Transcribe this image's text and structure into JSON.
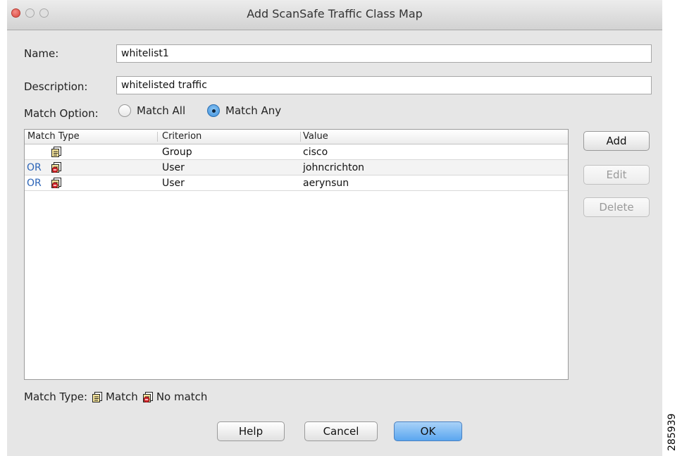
{
  "window": {
    "title": "Add ScanSafe Traffic Class Map"
  },
  "form": {
    "name_label": "Name:",
    "name_value": "whitelist1",
    "description_label": "Description:",
    "description_value": "whitelisted traffic",
    "match_option_label": "Match Option:",
    "match_all_label": "Match All",
    "match_any_label": "Match Any",
    "selected_option": "Match Any"
  },
  "table": {
    "headers": [
      "Match Type",
      "Criterion",
      "Value"
    ],
    "rows": [
      {
        "prefix": "",
        "match_type_icon": "match-icon",
        "criterion": "Group",
        "value": "cisco"
      },
      {
        "prefix": "OR",
        "match_type_icon": "no-match-icon",
        "criterion": "User",
        "value": "johncrichton"
      },
      {
        "prefix": "OR",
        "match_type_icon": "no-match-icon",
        "criterion": "User",
        "value": "aerynsun"
      }
    ]
  },
  "side_buttons": {
    "add": "Add",
    "edit": "Edit",
    "delete": "Delete"
  },
  "legend": {
    "label": "Match Type:",
    "match": "Match",
    "no_match": "No match"
  },
  "footer_buttons": {
    "help": "Help",
    "cancel": "Cancel",
    "ok": "OK"
  },
  "figure_id": "285939"
}
